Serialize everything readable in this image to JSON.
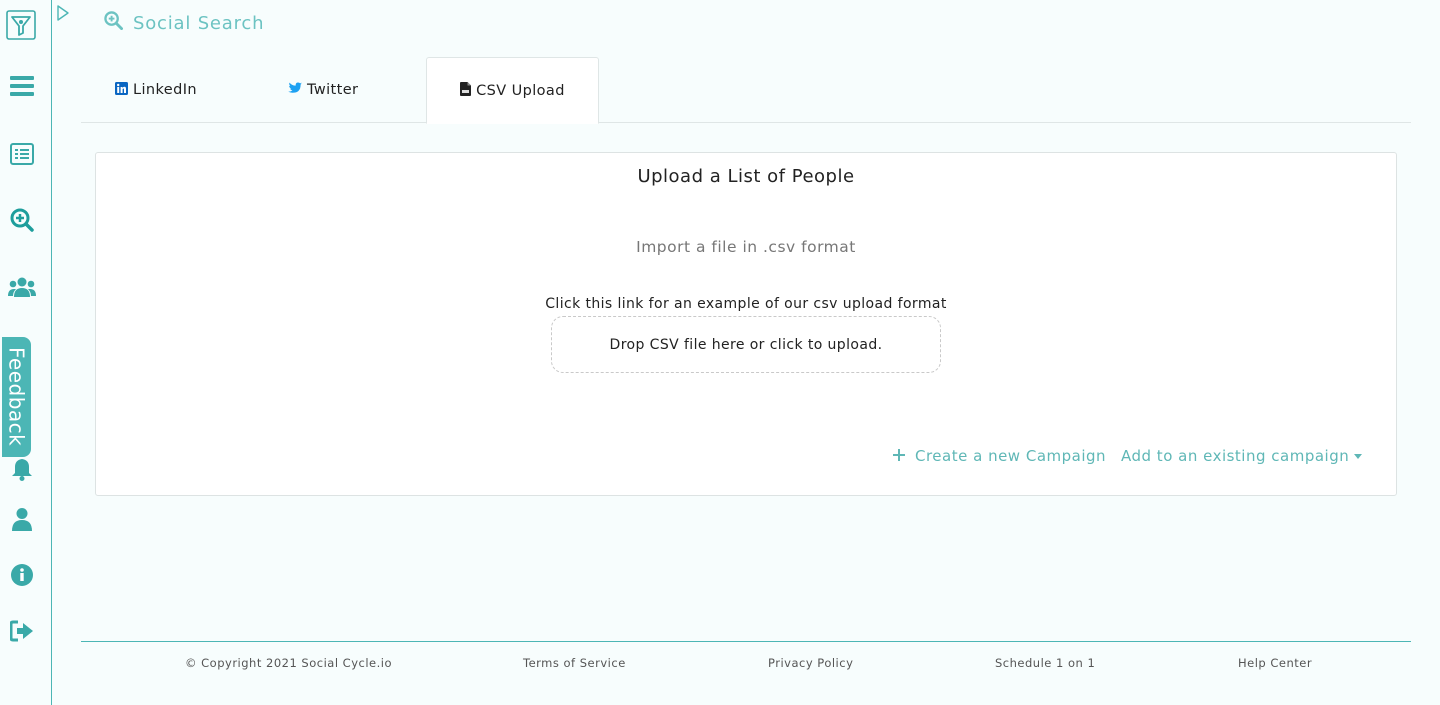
{
  "header": {
    "title": "Social Search",
    "icon": "search-plus-icon"
  },
  "sidebar": {
    "items": [
      {
        "name": "funnel-logo-icon"
      },
      {
        "name": "menu-icon"
      },
      {
        "name": "list-icon"
      },
      {
        "name": "social-search-icon"
      },
      {
        "name": "users-icon"
      },
      {
        "name": "bell-icon"
      },
      {
        "name": "user-icon"
      },
      {
        "name": "info-icon"
      },
      {
        "name": "logout-icon"
      }
    ],
    "feedback_label": "Feedback"
  },
  "tabs": [
    {
      "label": "LinkedIn",
      "icon": "linkedin-icon",
      "active": false
    },
    {
      "label": "Twitter",
      "icon": "twitter-icon",
      "active": false
    },
    {
      "label": "CSV Upload",
      "icon": "csv-file-icon",
      "active": true
    }
  ],
  "card": {
    "title": "Upload a List of People",
    "subtitle": "Import a file in .csv format",
    "example_link": "Click this link for an example of our csv upload format",
    "dropzone_text": "Drop CSV file here or click to upload.",
    "create_campaign_label": "Create a new Campaign",
    "add_existing_label": "Add to an existing campaign"
  },
  "footer": {
    "copyright": "© Copyright 2021 Social Cycle.io",
    "terms": "Terms of Service",
    "privacy": "Privacy Policy",
    "schedule": "Schedule 1 on 1",
    "help": "Help Center"
  },
  "colors": {
    "accent": "#4cb6b5",
    "accent_text": "#5fb7b6",
    "background": "#f7fdfd",
    "linkedin": "#0a66c2",
    "twitter": "#1da1f2"
  }
}
